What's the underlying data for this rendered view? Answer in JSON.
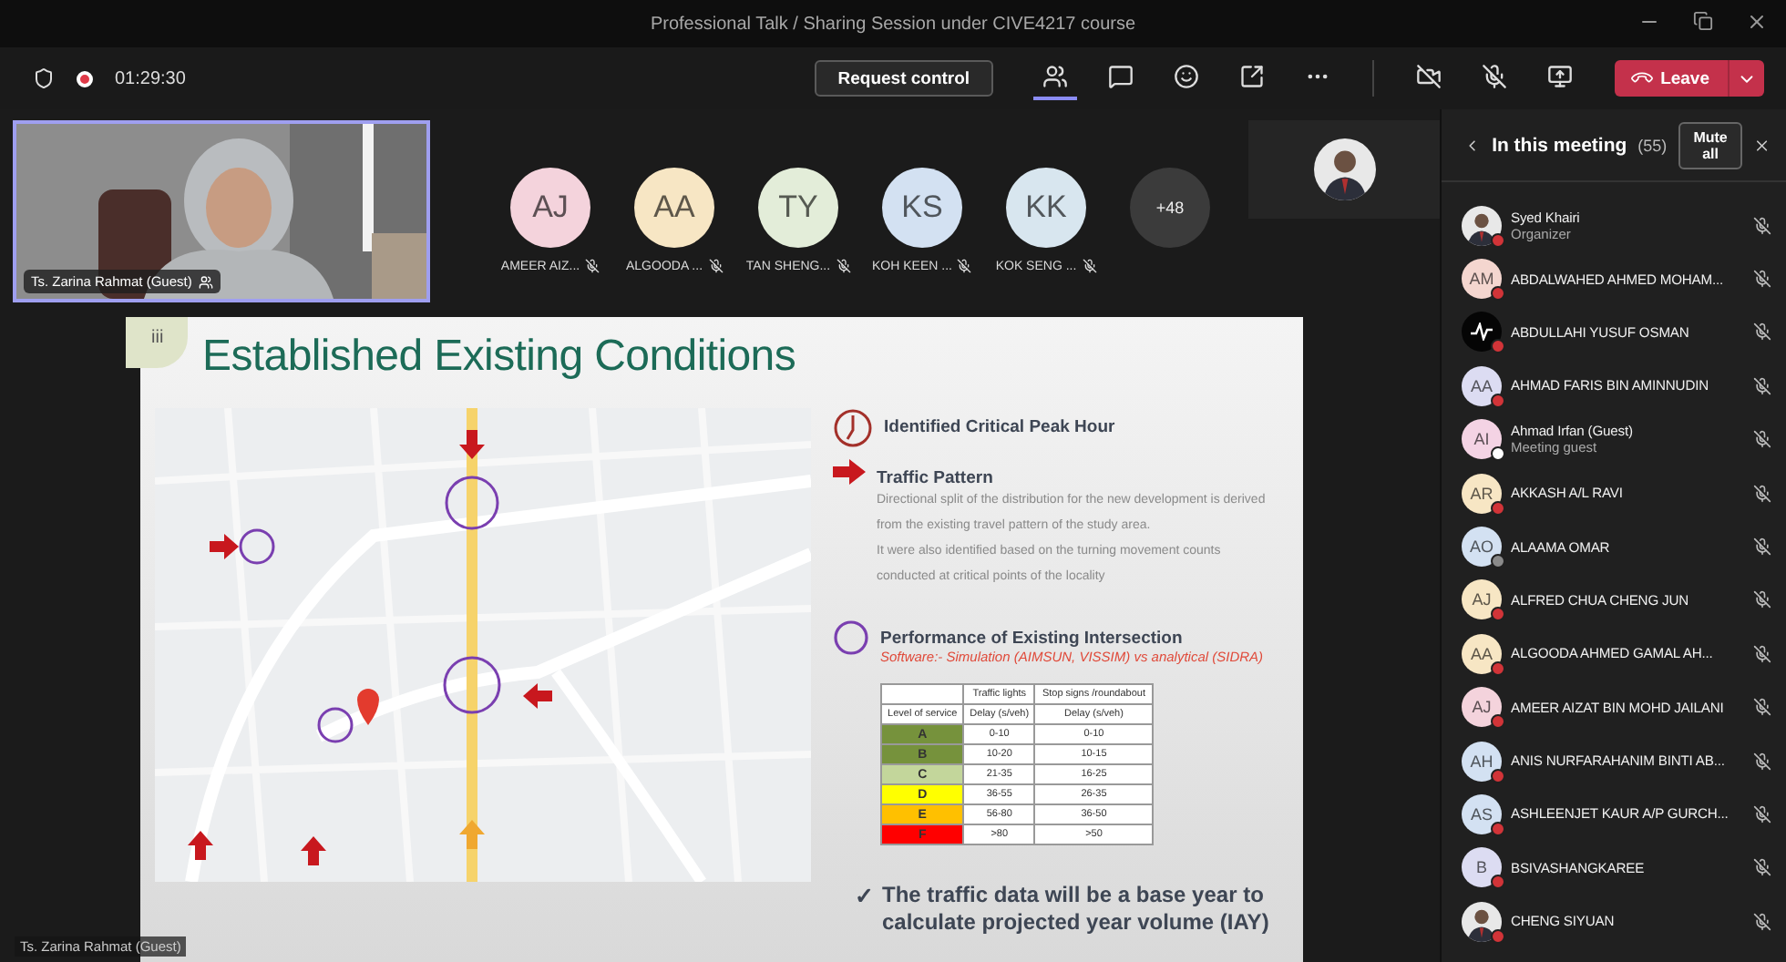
{
  "window": {
    "title": "Professional Talk / Sharing Session under CIVE4217 course"
  },
  "toolbar": {
    "recording": true,
    "timer": "01:29:30",
    "request_control": "Request control",
    "actions": [
      {
        "kind": "people",
        "selected": true
      },
      {
        "kind": "chat",
        "selected": false
      },
      {
        "kind": "reactions",
        "selected": false
      },
      {
        "kind": "rooms",
        "selected": false
      },
      {
        "kind": "more",
        "selected": false
      }
    ],
    "devices": [
      {
        "kind": "camera",
        "on": false
      },
      {
        "kind": "mic",
        "on": false
      },
      {
        "kind": "share"
      }
    ],
    "leave": "Leave"
  },
  "stage": {
    "speaker": {
      "name": "Ts. Zarina Rahmat (Guest)"
    },
    "attendees": [
      {
        "initials": "AJ",
        "name": "AMEER AIZ...",
        "color": "#f4d3dc",
        "muted": true
      },
      {
        "initials": "AA",
        "name": "ALGOODA ...",
        "color": "#f7e6c4",
        "muted": true
      },
      {
        "initials": "TY",
        "name": "TAN SHENG...",
        "color": "#e3edd9",
        "muted": true
      },
      {
        "initials": "KS",
        "name": "KOH KEEN ...",
        "color": "#d3e1f2",
        "muted": true
      },
      {
        "initials": "KK",
        "name": "KOK SENG ...",
        "color": "#d8e6ef",
        "muted": true
      }
    ],
    "overflow": "+48",
    "presenter_label": "Ts. Zarina Rahmat (Guest)"
  },
  "slide": {
    "number": "iii",
    "title": "Established Existing Conditions",
    "points": [
      {
        "kind": "clock",
        "heading": "Identified Critical Peak Hour"
      },
      {
        "kind": "arrow",
        "heading": "Traffic Pattern",
        "body": [
          "Directional split of the distribution for the new development is derived from the existing travel pattern of the study area.",
          "It were also identified based on the turning movement counts conducted at critical points of the locality"
        ]
      },
      {
        "kind": "circle",
        "heading": "Performance of Existing Intersection",
        "subtitle": "Software:- Simulation (AIMSUN, VISSIM) vs analytical (SIDRA)"
      }
    ],
    "los_table": {
      "headers": [
        "Traffic lights",
        "Stop signs /roundabout"
      ],
      "subheaders": [
        "Level of service",
        "Delay (s/veh)",
        "Delay (s/veh)"
      ],
      "rows": [
        {
          "grade": "A",
          "color": "#76923c",
          "signal": "0-10",
          "stop": "0-10"
        },
        {
          "grade": "B",
          "color": "#76923c",
          "signal": "10-20",
          "stop": "10-15"
        },
        {
          "grade": "C",
          "color": "#c3d69b",
          "signal": "21-35",
          "stop": "16-25"
        },
        {
          "grade": "D",
          "color": "#ffff00",
          "signal": "36-55",
          "stop": "26-35"
        },
        {
          "grade": "E",
          "color": "#ffc000",
          "signal": "56-80",
          "stop": "36-50"
        },
        {
          "grade": "F",
          "color": "#ff0000",
          "signal": ">80",
          "stop": ">50"
        }
      ]
    },
    "conclusion_mark": "✓",
    "conclusion": "The traffic data will be a base year to calculate projected year volume (IAY)"
  },
  "sidebar": {
    "title": "In this meeting",
    "count": "(55)",
    "mute_all": "Mute all",
    "participants": [
      {
        "name": "Syed Khairi",
        "role": "Organizer",
        "status": {
          "color": "#d13438"
        },
        "muted": true
      },
      {
        "kind": "initials",
        "initials": "AM",
        "name": "ABDALWAHED AHMED MOHAM...",
        "color": "#f4d6cf",
        "status": {
          "color": "#d13438"
        },
        "muted": true
      },
      {
        "kind": "logo",
        "name": "ABDULLAHI YUSUF OSMAN",
        "status": {
          "color": "#d13438"
        },
        "muted": true
      },
      {
        "kind": "initials",
        "initials": "AA",
        "name": "AHMAD FARIS BIN AMINNUDIN",
        "color": "#dcdcf2",
        "status": {
          "color": "#d13438"
        },
        "muted": true
      },
      {
        "kind": "initials",
        "initials": "AI",
        "name": "Ahmad Irfan (Guest)",
        "role": "Meeting guest",
        "color": "#f4d3e4",
        "status": {
          "color": "#ffffff"
        },
        "muted": true
      },
      {
        "kind": "initials",
        "initials": "AR",
        "name": "AKKASH A/L RAVI",
        "color": "#f7e6c4",
        "status": {
          "color": "#d13438"
        },
        "muted": true
      },
      {
        "kind": "initials",
        "initials": "AO",
        "name": "ALAAMA OMAR",
        "color": "#d3e1f2",
        "status": {
          "color": "#8a8a8a"
        },
        "muted": true
      },
      {
        "kind": "initials",
        "initials": "AJ",
        "name": "ALFRED CHUA CHENG JUN",
        "color": "#f7e6c4",
        "status": {
          "color": "#d13438"
        },
        "muted": true
      },
      {
        "kind": "initials",
        "initials": "AA",
        "name": "ALGOODA AHMED GAMAL AH...",
        "color": "#f7e6c4",
        "status": {
          "color": "#d13438"
        },
        "muted": true
      },
      {
        "kind": "initials",
        "initials": "AJ",
        "name": "AMEER AIZAT BIN MOHD JAILANI",
        "color": "#f4d3dc",
        "status": {
          "color": "#d13438"
        },
        "muted": true
      },
      {
        "kind": "initials",
        "initials": "AH",
        "name": "ANIS NURFARAHANIM BINTI AB...",
        "color": "#d3e1f2",
        "status": {
          "color": "#d13438"
        },
        "muted": true
      },
      {
        "kind": "initials",
        "initials": "AS",
        "name": "ASHLEENJET KAUR A/P GURCH...",
        "color": "#d3e1f2",
        "status": {
          "color": "#d13438"
        },
        "muted": true
      },
      {
        "kind": "initials",
        "initials": "B",
        "name": "BSIVASHANGKAREE",
        "color": "#dcdcf2",
        "status": {
          "color": "#d13438"
        },
        "muted": true
      },
      {
        "name": "CHENG SIYUAN",
        "status": {
          "color": "#d13438"
        },
        "muted": true
      }
    ]
  }
}
